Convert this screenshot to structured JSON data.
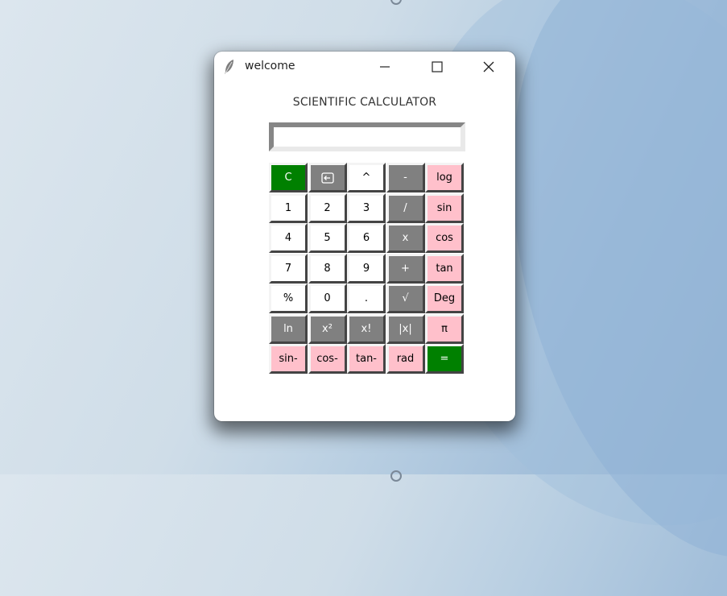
{
  "window": {
    "title": "welcome",
    "heading": "SCIENTIFIC CALCULATOR",
    "display_value": ""
  },
  "rows": [
    [
      {
        "label": "C",
        "name": "clear-button",
        "color": "green"
      },
      {
        "label": "",
        "name": "backspace-button",
        "color": "grey",
        "icon": "backspace-icon"
      },
      {
        "label": "^",
        "name": "power-button",
        "color": "white"
      },
      {
        "label": "-",
        "name": "minus-button",
        "color": "grey"
      },
      {
        "label": "log",
        "name": "log-button",
        "color": "pink"
      }
    ],
    [
      {
        "label": "1",
        "name": "digit-1-button",
        "color": "white"
      },
      {
        "label": "2",
        "name": "digit-2-button",
        "color": "white"
      },
      {
        "label": "3",
        "name": "digit-3-button",
        "color": "white"
      },
      {
        "label": "/",
        "name": "divide-button",
        "color": "grey"
      },
      {
        "label": "sin",
        "name": "sin-button",
        "color": "pink"
      }
    ],
    [
      {
        "label": "4",
        "name": "digit-4-button",
        "color": "white"
      },
      {
        "label": "5",
        "name": "digit-5-button",
        "color": "white"
      },
      {
        "label": "6",
        "name": "digit-6-button",
        "color": "white"
      },
      {
        "label": "x",
        "name": "multiply-button",
        "color": "grey"
      },
      {
        "label": "cos",
        "name": "cos-button",
        "color": "pink"
      }
    ],
    [
      {
        "label": "7",
        "name": "digit-7-button",
        "color": "white"
      },
      {
        "label": "8",
        "name": "digit-8-button",
        "color": "white"
      },
      {
        "label": "9",
        "name": "digit-9-button",
        "color": "white"
      },
      {
        "label": "+",
        "name": "plus-button",
        "color": "grey"
      },
      {
        "label": "tan",
        "name": "tan-button",
        "color": "pink"
      }
    ],
    [
      {
        "label": "%",
        "name": "percent-button",
        "color": "white"
      },
      {
        "label": "0",
        "name": "digit-0-button",
        "color": "white"
      },
      {
        "label": ".",
        "name": "decimal-button",
        "color": "white"
      },
      {
        "label": "√",
        "name": "sqrt-button",
        "color": "grey"
      },
      {
        "label": "Deg",
        "name": "deg-button",
        "color": "pink"
      }
    ],
    [
      {
        "label": "ln",
        "name": "ln-button",
        "color": "grey"
      },
      {
        "label": "x²",
        "name": "square-button",
        "color": "grey"
      },
      {
        "label": "x!",
        "name": "factorial-button",
        "color": "grey"
      },
      {
        "label": "|x|",
        "name": "abs-button",
        "color": "grey"
      },
      {
        "label": "π",
        "name": "pi-button",
        "color": "pink"
      }
    ],
    [
      {
        "label": "sin-",
        "name": "asin-button",
        "color": "pink"
      },
      {
        "label": "cos-",
        "name": "acos-button",
        "color": "pink"
      },
      {
        "label": "tan-",
        "name": "atan-button",
        "color": "pink"
      },
      {
        "label": "rad",
        "name": "rad-button",
        "color": "pink"
      },
      {
        "label": "=",
        "name": "equals-button",
        "color": "green"
      }
    ]
  ],
  "colors": {
    "white": "#ffffff",
    "grey": "#808080",
    "pink": "#ffc0cb",
    "green": "#008000"
  }
}
